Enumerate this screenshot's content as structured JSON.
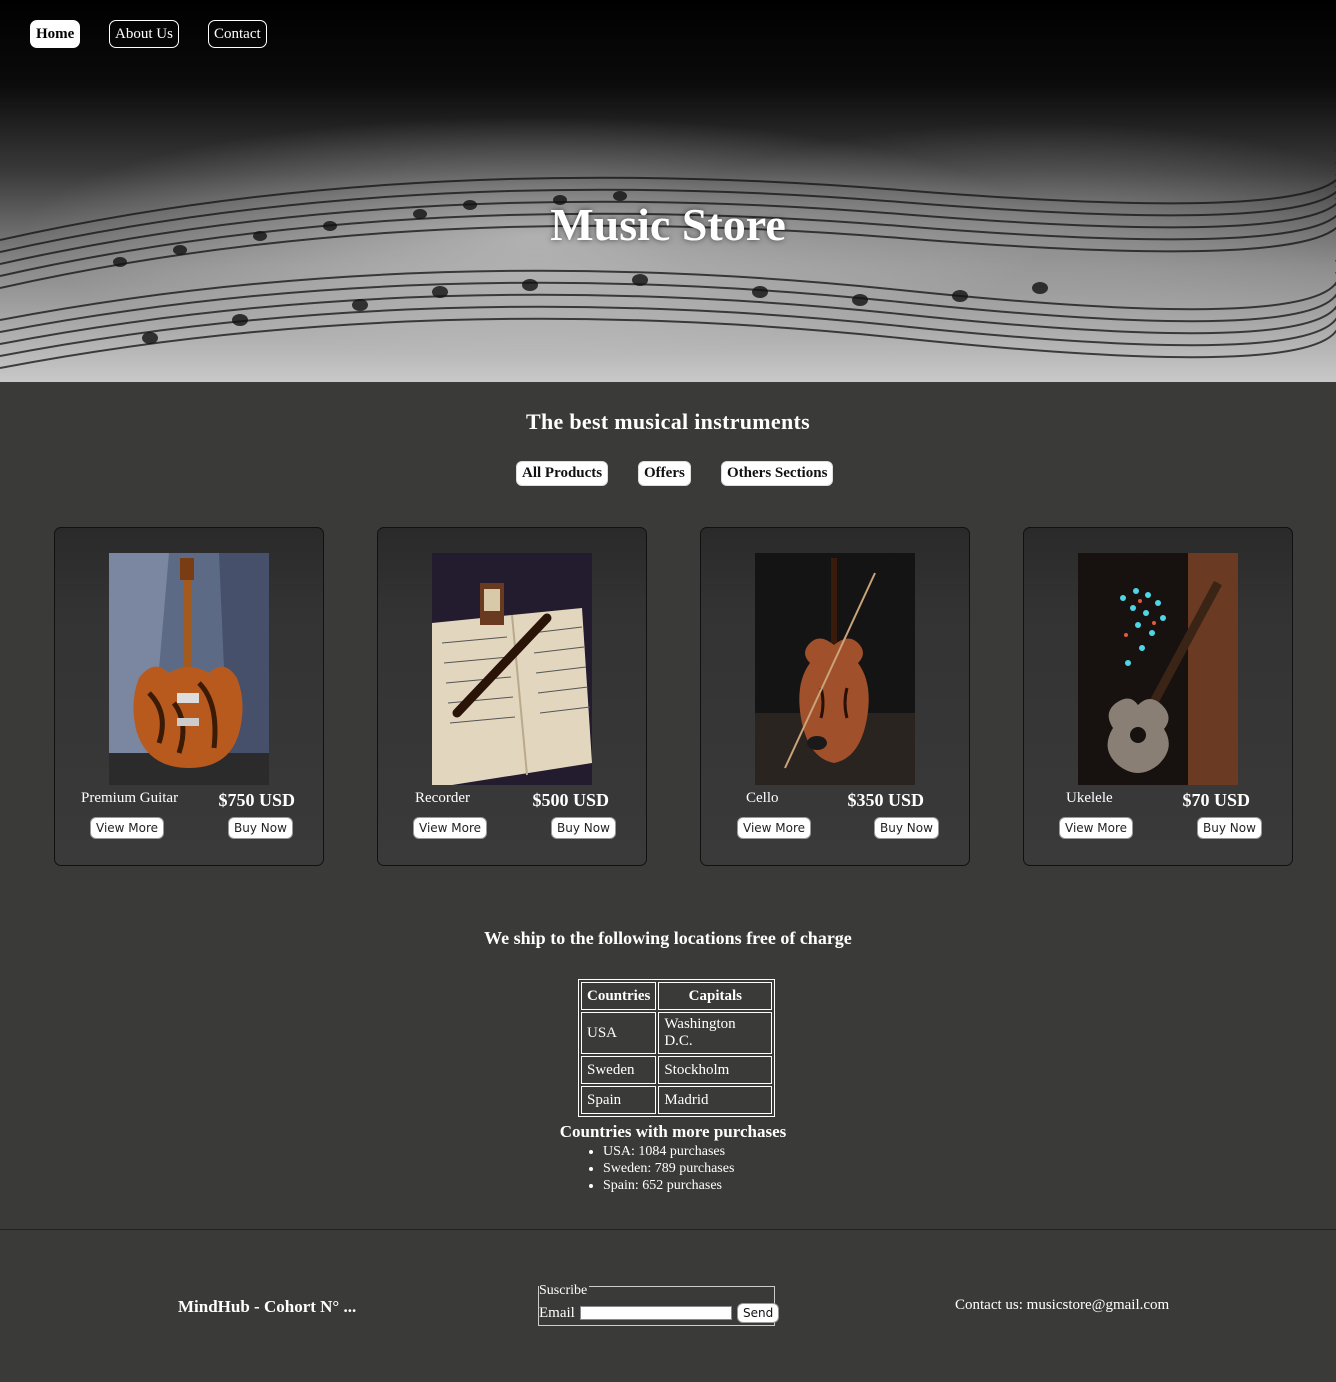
{
  "nav": {
    "home": "Home",
    "about": "About Us",
    "contact": "Contact"
  },
  "hero": {
    "title": "Music Store"
  },
  "catalog": {
    "heading": "The best musical instruments",
    "tabs": [
      "All Products",
      "Offers",
      "Others Sections"
    ],
    "products": [
      {
        "name": "Premium Guitar",
        "price": "$750 USD",
        "view": "View More",
        "buy": "Buy Now"
      },
      {
        "name": "Recorder",
        "price": "$500 USD",
        "view": "View More",
        "buy": "Buy Now"
      },
      {
        "name": "Cello",
        "price": "$350 USD",
        "view": "View More",
        "buy": "Buy Now"
      },
      {
        "name": "Ukelele",
        "price": "$70 USD",
        "view": "View More",
        "buy": "Buy Now"
      }
    ]
  },
  "shipping": {
    "title": "We ship to the following locations free of charge",
    "headers": [
      "Countries",
      "Capitals"
    ],
    "rows": [
      [
        "USA",
        "Washington D.C."
      ],
      [
        "Sweden",
        "Stockholm"
      ],
      [
        "Spain",
        "Madrid"
      ]
    ]
  },
  "purchases": {
    "title": "Countries with more purchases",
    "items": [
      "USA: 1084 purchases",
      "Sweden: 789 purchases",
      "Spain: 652 purchases"
    ]
  },
  "footer": {
    "brand": "MindHub - Cohort N° ...",
    "subscribe_legend": "Suscribe",
    "email_label": "Email",
    "send": "Send",
    "contact": "Contact us: musicstore@gmail.com"
  }
}
